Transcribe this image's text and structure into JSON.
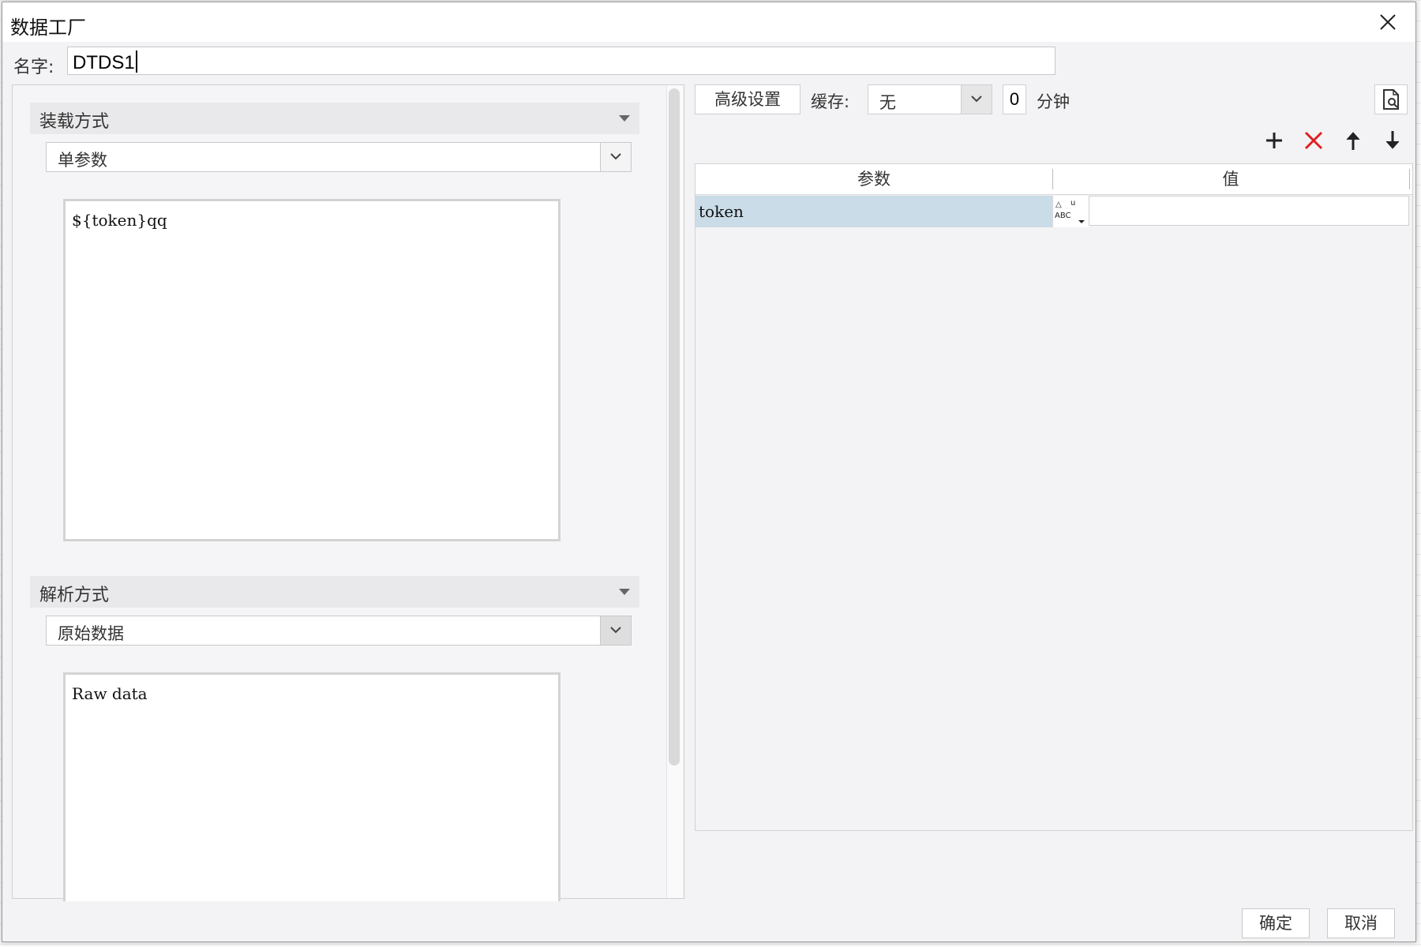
{
  "window": {
    "title": "数据工厂"
  },
  "name_row": {
    "label": "名字:",
    "value": "DTDS1"
  },
  "load": {
    "header": "装载方式",
    "selected": "单参数",
    "content": "${token}qq"
  },
  "parse": {
    "header": "解析方式",
    "selected": "原始数据",
    "content": "Raw data"
  },
  "toolbar": {
    "advanced_label": "高级设置",
    "cache_label": "缓存:",
    "cache_value": "无",
    "minutes_value": "0",
    "minutes_label": "分钟"
  },
  "table": {
    "columns": [
      "参数",
      "值"
    ],
    "rows": [
      {
        "param": "token",
        "value": ""
      }
    ]
  },
  "footer": {
    "ok_label": "确定",
    "cancel_label": "取消"
  },
  "colors": {
    "selected_row": "#c9dce8",
    "delete": "#e02020"
  }
}
